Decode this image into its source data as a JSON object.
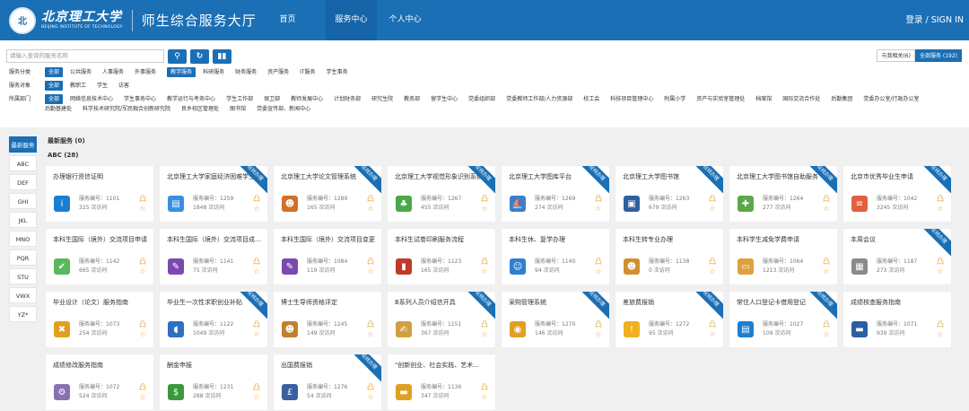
{
  "header": {
    "seal": "北",
    "uni_cn": "北京理工大学",
    "uni_en": "BEIJING INSTITUTE OF TECHNOLOGY",
    "system": "师生综合服务大厅",
    "nav": [
      "首页",
      "服务中心",
      "个人中心"
    ],
    "login": "登录 / SIGN IN"
  },
  "search": {
    "placeholder": "请输入查询的服务名称",
    "btn_search": "⚲",
    "btn_refresh": "↻",
    "btn_chart": "▮▮"
  },
  "scope": {
    "related": "与我相关(6)",
    "all": "全部服务 (192)"
  },
  "filters": [
    {
      "label": "服务分类",
      "options": [
        "全部",
        "公共服务",
        "人事服务",
        "外事服务",
        "教学服务",
        "科研服务",
        "财务服务",
        "资产服务",
        "IT服务",
        "学生事务"
      ],
      "active": [
        0,
        4
      ]
    },
    {
      "label": "服务对象",
      "options": [
        "全部",
        "教职工",
        "学生",
        "访客"
      ],
      "active": [
        0
      ]
    },
    {
      "label": "所属部门",
      "options": [
        "全部",
        "网络信息技术中心",
        "学生事务中心",
        "教学运行与考务中心",
        "学生工作部",
        "保卫部",
        "教师发展中心",
        "计划财务部",
        "研究生院",
        "教务部",
        "留学生中心",
        "党委组织部",
        "党委教师工作部/人力资源部",
        "校工会",
        "科技项目管理中心",
        "附属小学",
        "资产与实验室管理处",
        "档案馆",
        "国际交流合作处",
        "后勤集团",
        "党委办公室/行政办公室",
        "后勤基建处",
        "科学技术研究院/军民融合创新研究院",
        "良乡校区管理处",
        "图书馆",
        "党委宣传部、新闻中心"
      ],
      "active": [
        0
      ]
    }
  ],
  "side": [
    "最新服务",
    "ABC",
    "DEF",
    "GHI",
    "JKL",
    "MNO",
    "PQR",
    "STU",
    "VWX",
    "YZ*"
  ],
  "sections": {
    "latest": "最新服务 (0)",
    "abc": "ABC (28)"
  },
  "labels": {
    "no": "服务编号：",
    "visits": "次访问",
    "online": "在线办理",
    "star": "☆",
    "lock": "凸"
  },
  "cards": [
    {
      "title": "办理银行资信证明",
      "no": "1101",
      "visits": "325",
      "online": false,
      "icon": "i",
      "color": "#1a7fd4"
    },
    {
      "title": "北京理工大学家庭经济困难学生认定",
      "no": "1259",
      "visits": "1848",
      "online": true,
      "icon": "▤",
      "color": "#3b8fe0"
    },
    {
      "title": "北京理工大学论文管理系统",
      "no": "1289",
      "visits": "165",
      "online": true,
      "icon": "☻",
      "color": "#d0702a"
    },
    {
      "title": "北京理工大学视觉形象识别系统",
      "no": "1267",
      "visits": "455",
      "online": true,
      "icon": "♣",
      "color": "#4aa84a"
    },
    {
      "title": "北京理工大学图库平台",
      "no": "1269",
      "visits": "274",
      "online": true,
      "icon": "⛵",
      "color": "#3a7fd0"
    },
    {
      "title": "北京理工大学图书馆",
      "no": "1263",
      "visits": "679",
      "online": true,
      "icon": "▣",
      "color": "#2f5f9f"
    },
    {
      "title": "北京理工大学图书馆自助服务",
      "no": "1264",
      "visits": "277",
      "online": true,
      "icon": "✚",
      "color": "#5aa84a"
    },
    {
      "title": "北京市优秀毕业生申请",
      "no": "1042",
      "visits": "3245",
      "online": true,
      "icon": "≡",
      "color": "#e06040"
    },
    {
      "title": "本科生国际（境外）交流项目申请",
      "no": "1142",
      "visits": "665",
      "online": false,
      "icon": "✔",
      "color": "#5ab85a"
    },
    {
      "title": "本科生国际（境外）交流项目成绩认定",
      "no": "1141",
      "visits": "75",
      "online": false,
      "icon": "✎",
      "color": "#7a4ab0"
    },
    {
      "title": "本科生国际（境外）交流项目变更",
      "no": "1084",
      "visits": "119",
      "online": false,
      "icon": "✎",
      "color": "#7a4ab0"
    },
    {
      "title": "本科生试卷印刷服务流程",
      "no": "1123",
      "visits": "165",
      "online": false,
      "icon": "▮",
      "color": "#c0392b"
    },
    {
      "title": "本科生休、复学办理",
      "no": "1140",
      "visits": "94",
      "online": false,
      "icon": "☺",
      "color": "#2f7fd0"
    },
    {
      "title": "本科生转专业办理",
      "no": "1138",
      "visits": "0",
      "online": false,
      "icon": "☻",
      "color": "#d09030"
    },
    {
      "title": "本科学生减免学费申请",
      "no": "1064",
      "visits": "1213",
      "online": false,
      "icon": "▭",
      "color": "#e0a040"
    },
    {
      "title": "本周会议",
      "no": "1187",
      "visits": "273",
      "online": true,
      "icon": "▦",
      "color": "#8a8a8a"
    },
    {
      "title": "毕业设计（论文）服务指南",
      "no": "1073",
      "visits": "254",
      "online": false,
      "icon": "✖",
      "color": "#e0a020"
    },
    {
      "title": "毕业生一次性求职创业补贴",
      "no": "1122",
      "visits": "1049",
      "online": true,
      "icon": "◖",
      "color": "#2f6fc0"
    },
    {
      "title": "博士生导师资格评定",
      "no": "1245",
      "visits": "149",
      "online": false,
      "icon": "☻",
      "color": "#c08030"
    },
    {
      "title": "B系列人员介绍信开具",
      "no": "1151",
      "visits": "367",
      "online": true,
      "icon": "✍",
      "color": "#d0a040"
    },
    {
      "title": "采购管理系统",
      "no": "1270",
      "visits": "146",
      "online": true,
      "icon": "◉",
      "color": "#e0a020"
    },
    {
      "title": "差旅费报销",
      "no": "1272",
      "visits": "95",
      "online": true,
      "icon": "!",
      "color": "#f0b020"
    },
    {
      "title": "常住人口登记卡借用登记",
      "no": "1027",
      "visits": "109",
      "online": true,
      "icon": "▤",
      "color": "#1a7fd4"
    },
    {
      "title": "成绩核查服务指南",
      "no": "1071",
      "visits": "939",
      "online": false,
      "icon": "▬",
      "color": "#2a5fa0"
    },
    {
      "title": "成绩修改服务指南",
      "no": "1072",
      "visits": "524",
      "online": false,
      "icon": "⚙",
      "color": "#8a70b0"
    },
    {
      "title": "酬金申报",
      "no": "1231",
      "visits": "288",
      "online": false,
      "icon": "$",
      "color": "#3a9a3a"
    },
    {
      "title": "出国费报销",
      "no": "1276",
      "visits": "54",
      "online": true,
      "icon": "£",
      "color": "#3a5fa0"
    },
    {
      "title": "\"创新创业、社会实践、艺术...",
      "no": "1136",
      "visits": "347",
      "online": false,
      "icon": "▬",
      "color": "#e0a020"
    }
  ]
}
